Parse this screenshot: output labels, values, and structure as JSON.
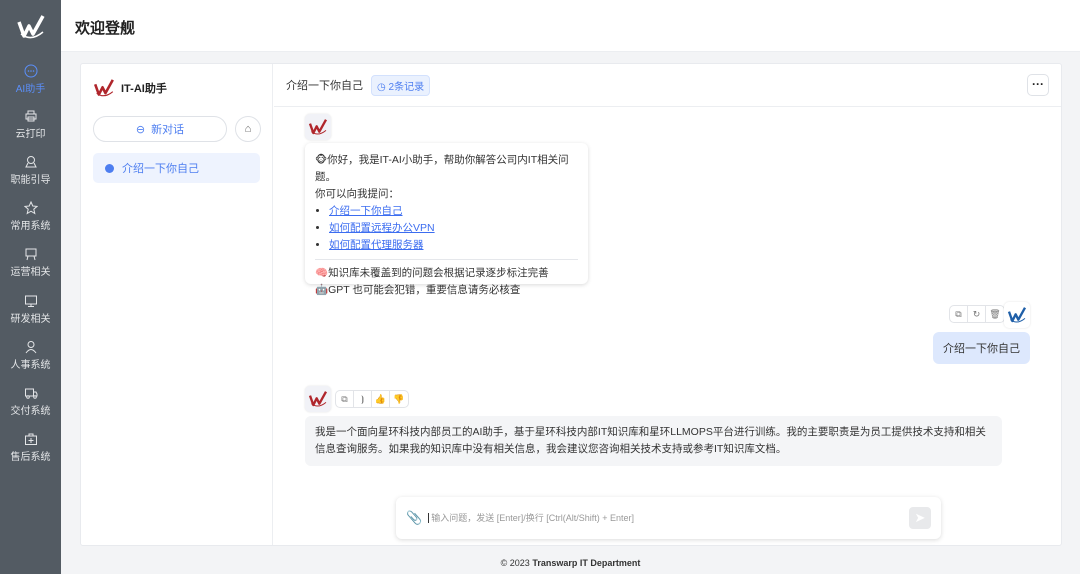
{
  "header": {
    "title": "欢迎登舰"
  },
  "sidebar": {
    "items": [
      {
        "label": "AI助手",
        "icon": "chat-icon",
        "active": true
      },
      {
        "label": "云打印",
        "icon": "printer-icon"
      },
      {
        "label": "职能引导",
        "icon": "badge-icon"
      },
      {
        "label": "常用系统",
        "icon": "star-icon"
      },
      {
        "label": "运营相关",
        "icon": "presentation-icon"
      },
      {
        "label": "研发相关",
        "icon": "monitor-icon"
      },
      {
        "label": "人事系统",
        "icon": "user-icon"
      },
      {
        "label": "交付系统",
        "icon": "truck-icon"
      },
      {
        "label": "售后系统",
        "icon": "medkit-icon"
      }
    ]
  },
  "panel": {
    "brand": "IT-AI助手",
    "new_chat": "新对话",
    "conversations": [
      {
        "title": "介绍一下你自己"
      }
    ]
  },
  "chat": {
    "title": "介绍一下你自己",
    "records": "2条记录",
    "welcome": {
      "greeting": "🐵你好，我是IT-AI小助手，帮助你解答公司内IT相关问题。",
      "prompt": "你可以向我提问：",
      "links": [
        "介绍一下你自己",
        "如何配置远程办公VPN",
        "如何配置代理服务器"
      ],
      "note1": "🧠知识库未覆盖到的问题会根据记录逐步标注完善",
      "note2": "🤖GPT 也可能会犯错，重要信息请务必核查"
    },
    "user_message": "介绍一下你自己",
    "answer": "我是一个面向星环科技内部员工的AI助手，基于星环科技内部IT知识库和星环LLMOPS平台进行训练。我的主要职责是为员工提供技术支持和相关信息查询服务。如果我的知识库中没有相关信息，我会建议您咨询相关技术支持或参考IT知识库文档。",
    "input_placeholder": "输入问题，发送 [Enter]/换行 [Ctrl(Alt/Shift) + Enter]"
  },
  "footer": {
    "copyright": "© 2023",
    "org": "Transwarp IT Department"
  },
  "colors": {
    "sidebar": "#535b63",
    "accent": "#4d7ef0",
    "brand_red": "#b0262c"
  }
}
